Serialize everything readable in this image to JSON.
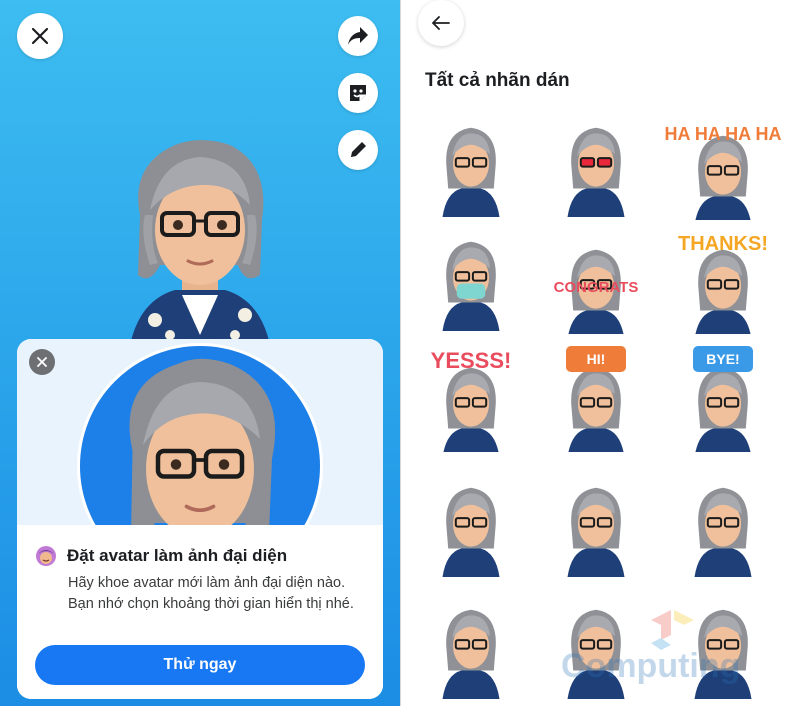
{
  "left_panel": {
    "icons": {
      "close": "close-icon",
      "share": "share-arrow-icon",
      "sticker": "sticker-icon",
      "edit": "pencil-icon"
    },
    "card": {
      "title": "Đặt avatar làm ảnh đại diện",
      "description": "Hãy khoe avatar mới làm ảnh đại diện nào. Bạn nhớ chọn khoảng thời gian hiển thị nhé.",
      "button_label": "Thử ngay"
    }
  },
  "right_panel": {
    "title": "Tất cả nhãn dán",
    "stickers": [
      {
        "name": "thumbs-up",
        "text": ""
      },
      {
        "name": "heart-eyes",
        "text": ""
      },
      {
        "name": "haha-laughing",
        "text": "HA HA HA HA"
      },
      {
        "name": "face-mask",
        "text": ""
      },
      {
        "name": "congrats",
        "text": "CONGRATS"
      },
      {
        "name": "thanks",
        "text": "THANKS!"
      },
      {
        "name": "yesss",
        "text": "YESSS!"
      },
      {
        "name": "hi",
        "text": "HI!"
      },
      {
        "name": "bye",
        "text": "BYE!"
      },
      {
        "name": "crying",
        "text": ""
      },
      {
        "name": "facepalm",
        "text": ""
      },
      {
        "name": "sparkle-happy",
        "text": ""
      },
      {
        "name": "waving",
        "text": ""
      },
      {
        "name": "celebrate",
        "text": ""
      },
      {
        "name": "star-heart",
        "text": ""
      }
    ],
    "watermark": "Computing"
  },
  "colors": {
    "accent": "#1877f2",
    "left_bg_top": "#3dbdf1",
    "left_bg_bottom": "#1b8de4"
  }
}
